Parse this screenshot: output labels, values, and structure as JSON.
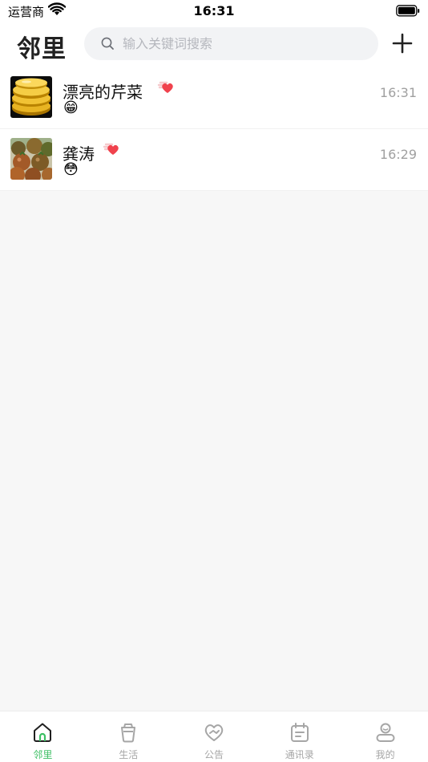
{
  "status_bar": {
    "carrier": "运营商",
    "time": "16:31"
  },
  "header": {
    "title": "邻里",
    "search_placeholder": "输入关键词搜索"
  },
  "chats": [
    {
      "name": "漂亮的芹菜",
      "preview": "😁",
      "time": "16:31",
      "avatar": "gold-coins"
    },
    {
      "name": "龚涛",
      "preview": "😳",
      "time": "16:29",
      "avatar": "tomatoes"
    }
  ],
  "tabs": [
    {
      "label": "邻里",
      "icon": "home-icon",
      "active": true
    },
    {
      "label": "生活",
      "icon": "cup-icon",
      "active": false
    },
    {
      "label": "公告",
      "icon": "heart-hand-icon",
      "active": false
    },
    {
      "label": "通讯录",
      "icon": "calendar-icon",
      "active": false
    },
    {
      "label": "我的",
      "icon": "user-icon",
      "active": false
    }
  ],
  "colors": {
    "accent": "#3cbf63",
    "heart": "#f0424d",
    "inactive": "#a6a6a6"
  }
}
